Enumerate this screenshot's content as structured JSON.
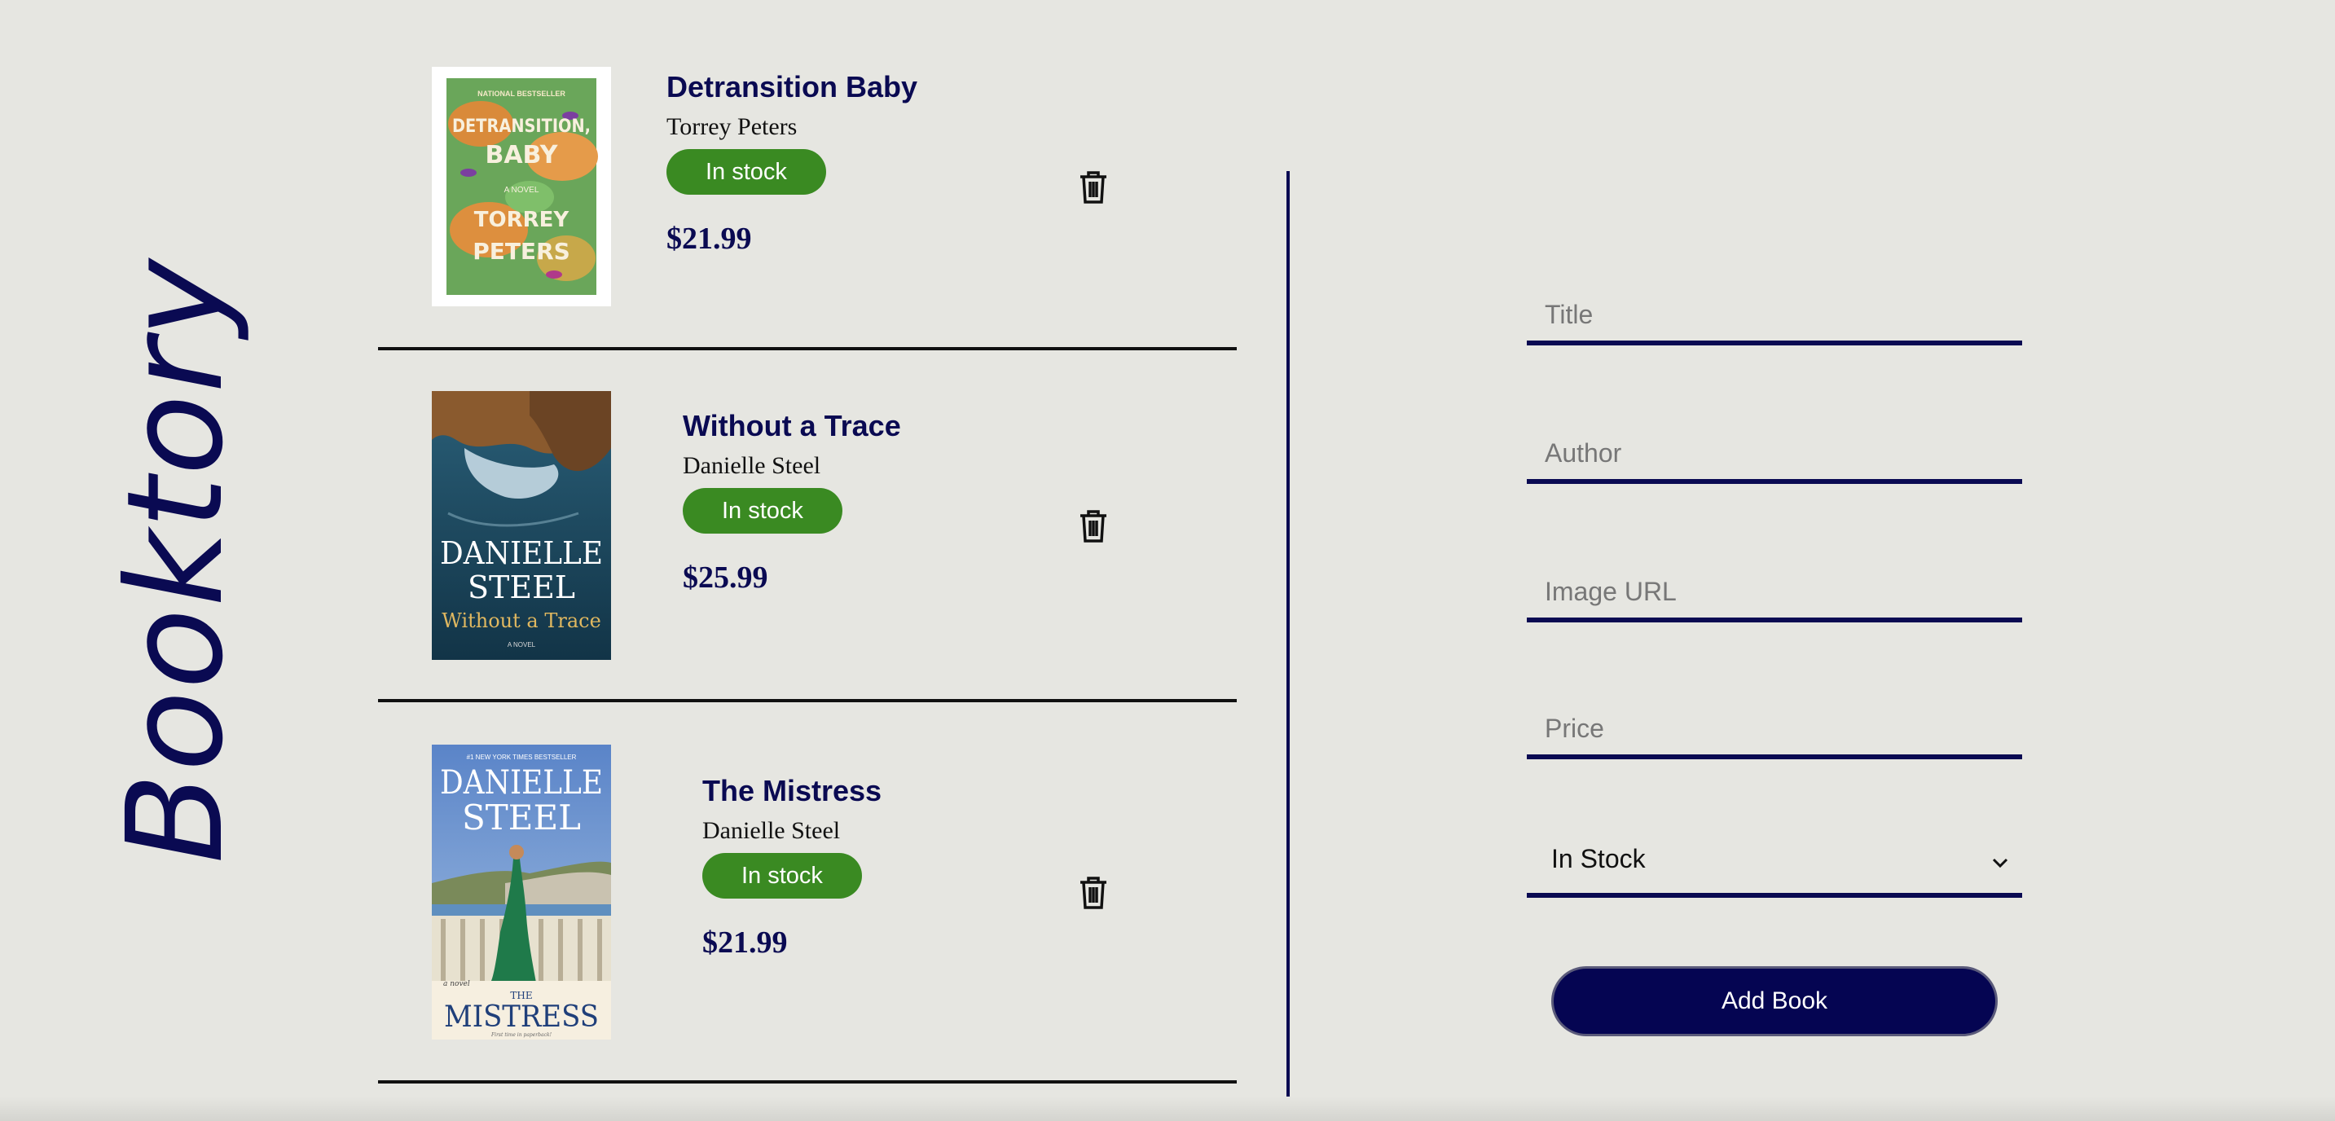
{
  "app": {
    "brand": "Booktory"
  },
  "books": [
    {
      "title": "Detransition Baby",
      "author": "Torrey Peters",
      "stock_status": "In stock",
      "price": "$21.99",
      "cover": {
        "top_text": "NATIONAL BESTSELLER",
        "title_text": "DETRANSITION, BABY",
        "subtitle_text": "A NOVEL",
        "author_text": "TORREY PETERS"
      }
    },
    {
      "title": "Without a Trace",
      "author": "Danielle Steel",
      "stock_status": "In stock",
      "price": "$25.99",
      "cover": {
        "author_text": "DANIELLE STEEL",
        "title_text": "Without a Trace",
        "subtitle_text": "A NOVEL"
      }
    },
    {
      "title": "The Mistress",
      "author": "Danielle Steel",
      "stock_status": "In stock",
      "price": "$21.99",
      "cover": {
        "top_text": "#1 NEW YORK TIMES BESTSELLER",
        "author_text": "DANIELLE STEEL",
        "subtitle_text": "a novel",
        "title_text": "THE MISTRESS",
        "tagline": "First time in paperback!"
      }
    }
  ],
  "form": {
    "title_placeholder": "Title",
    "author_placeholder": "Author",
    "image_url_placeholder": "Image URL",
    "price_placeholder": "Price",
    "stock_select_value": "In Stock",
    "submit_label": "Add Book"
  },
  "icons": {
    "delete": "trash-icon",
    "select": "chevron-down-icon"
  },
  "colors": {
    "background": "#e6e6e1",
    "navy": "#0a0a52",
    "stock_green": "#3a8a22",
    "button": "#050552"
  }
}
